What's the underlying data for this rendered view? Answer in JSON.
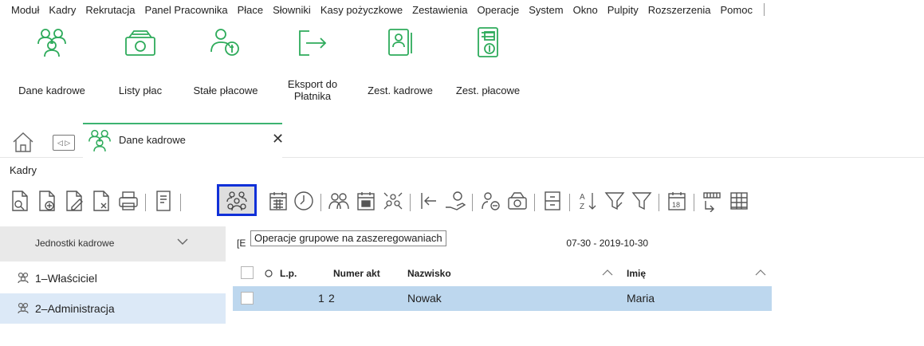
{
  "menu": [
    "Moduł",
    "Kadry",
    "Rekrutacja",
    "Panel Pracownika",
    "Płace",
    "Słowniki",
    "Kasy pożyczkowe",
    "Zestawienia",
    "Operacje",
    "System",
    "Okno",
    "Pulpity",
    "Rozszerzenia",
    "Pomoc"
  ],
  "ribbon": {
    "dane_kadrowe": "Dane kadrowe",
    "listy_plac": "Listy płac",
    "stale_placowe": "Stałe płacowe",
    "eksport": "Eksport do Płatnika",
    "zest_kadrowe": "Zest. kadrowe",
    "zest_placowe": "Zest. płacowe"
  },
  "tab": {
    "label": "Dane kadrowe",
    "close": "✕"
  },
  "section_label": "Kadry",
  "tooltip": "Operacje grupowe na zaszeregowaniach",
  "left_panel": {
    "header": "Jednostki kadrowe",
    "items": [
      "1–Właściciel",
      "2–Administracja"
    ]
  },
  "grid": {
    "date_prefix": "[E",
    "date_range": "07-30 - 2019-10-30",
    "columns": {
      "o": "O",
      "lp": "L.p.",
      "numer": "Numer akt",
      "nazwisko": "Nazwisko",
      "imie": "Imię"
    },
    "rows": [
      {
        "lp": "1",
        "numer": "2",
        "nazwisko": "Nowak",
        "imie": "Maria"
      }
    ]
  },
  "colors": {
    "ribbon_icon": "#2eab5b",
    "highlight_border": "#1030d8",
    "selected_row": "#bdd7ee",
    "tab_accent": "#3cb371"
  }
}
